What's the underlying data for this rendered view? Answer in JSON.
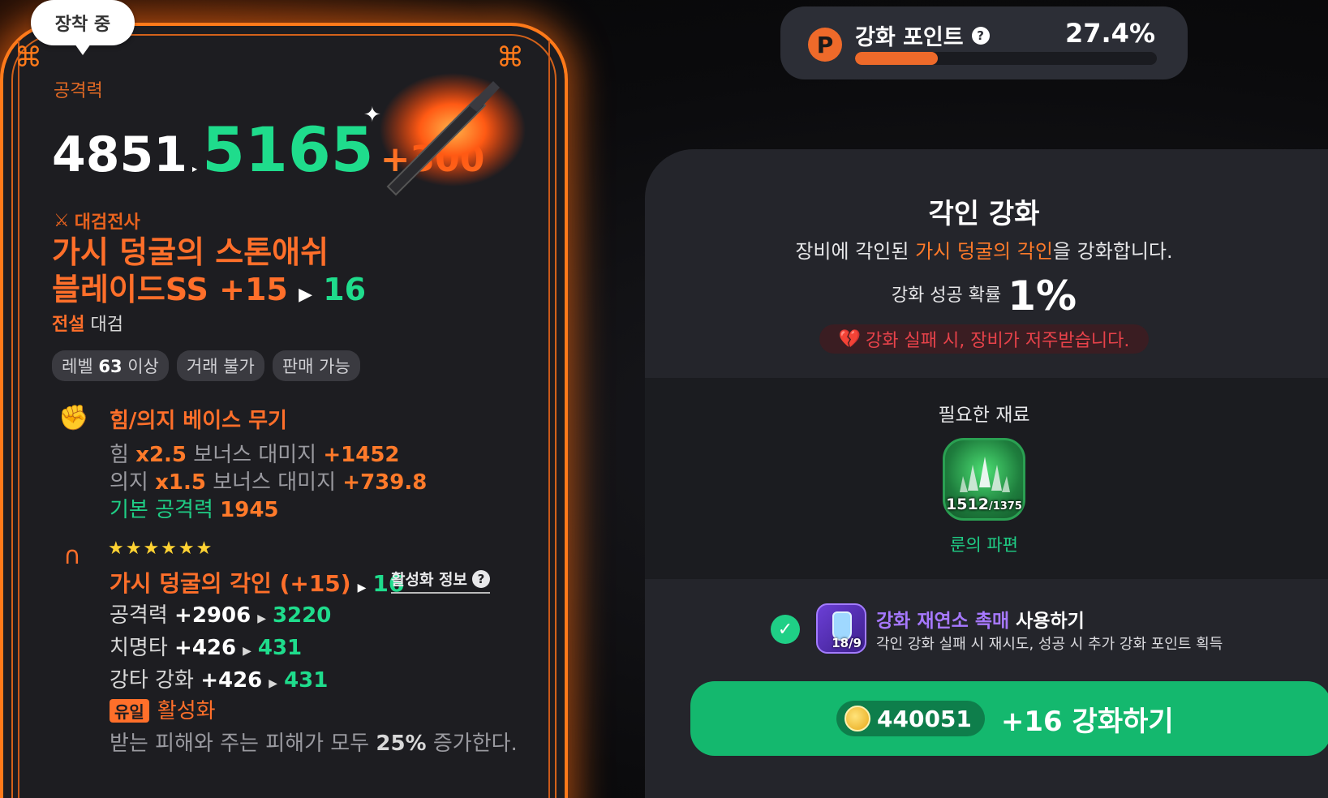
{
  "equip_badge": "장착 중",
  "attack": {
    "label": "공격력",
    "old": "4851",
    "new": "5165",
    "bonus": "+300"
  },
  "item": {
    "class": "대검전사",
    "name_line1": "가시 덩굴의 스톤애쉬",
    "name_line2": "블레이드SS +15",
    "name_next": "16",
    "grade": "전설",
    "type": "대검"
  },
  "tags": [
    {
      "pre": "레벨 ",
      "bold": "63",
      "post": " 이상"
    },
    {
      "pre": "거래 불가",
      "bold": "",
      "post": ""
    },
    {
      "pre": "판매 가능",
      "bold": "",
      "post": ""
    }
  ],
  "base_weapon": {
    "title": "힘/의지 베이스 무기",
    "line1": {
      "a": "힘 ",
      "mult": "x2.5",
      "b": " 보너스 대미지 ",
      "val": "+1452"
    },
    "line2": {
      "a": "의지 ",
      "mult": "x1.5",
      "b": " 보너스 대미지 ",
      "val": "+739.8"
    },
    "line3": {
      "a": "기본 공격력 ",
      "val": "1945"
    }
  },
  "engrave": {
    "stars": "★★★★★★",
    "title": "가시 덩굴의 각인 (+15)",
    "next": "16",
    "info_label": "활성화 정보",
    "stats": [
      {
        "name": "공격력 ",
        "from": "+2906",
        "to": "3220"
      },
      {
        "name": "치명타 ",
        "from": "+426",
        "to": "431"
      },
      {
        "name": "강타 강화 ",
        "from": "+426",
        "to": "431"
      }
    ],
    "unique_badge": "유일",
    "activate": "활성화",
    "desc_a": "받는 피해와 주는 피해가 모두 ",
    "desc_val": "25%",
    "desc_b": " 증가한다."
  },
  "points": {
    "icon": "P",
    "label": "강화 포인트",
    "value": "27.4%",
    "progress": 0.274
  },
  "panel": {
    "title": "각인 강화",
    "desc_a": "장비에 각인된 ",
    "desc_highlight": "가시 덩굴의 각인",
    "desc_b": "을 강화합니다.",
    "rate_label": "강화 성공 확률",
    "rate_value": "1%",
    "curse_warning": "강화 실패 시, 장비가 저주받습니다.",
    "materials_title": "필요한 재료",
    "material": {
      "have": "1512",
      "need": "/1375",
      "name": "룬의 파편"
    },
    "boost": {
      "title_highlight": "강화 재연소 촉매",
      "title_rest": " 사용하기",
      "desc": "각인 강화 실패 시 재시도, 성공 시 추가 강화 포인트 획득",
      "count": "18/9"
    },
    "button": {
      "cost": "440051",
      "label": "+16 강화하기"
    }
  },
  "colors": {
    "accent_orange": "#ff6f2a",
    "accent_green": "#1fdc8c",
    "button_green": "#14b86e",
    "curse_red": "#e8424a",
    "boost_purple": "#a678ff"
  }
}
